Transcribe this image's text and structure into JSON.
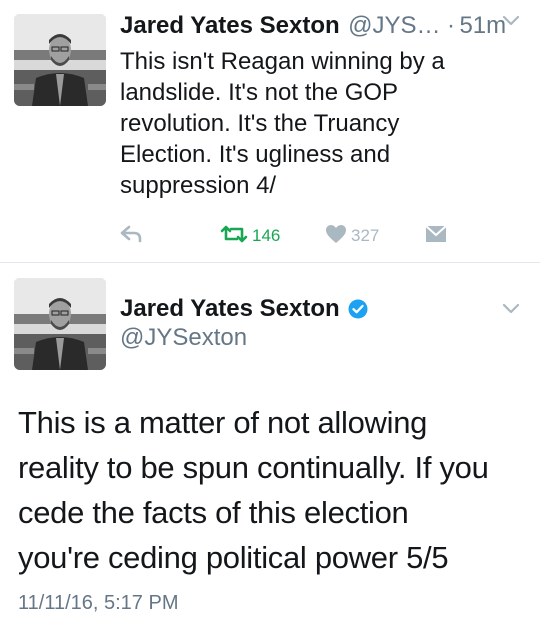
{
  "tweet1": {
    "name": "Jared Yates Sexton",
    "handle": "@JYS…",
    "dot": "·",
    "time": "51m",
    "text": "This isn't Reagan winning by a\nlandslide. It's not the GOP\nrevolution. It's the Truancy\nElection. It's ugliness and\nsuppression 4/",
    "retweet_count": "146",
    "like_count": "327",
    "icons": [
      "reply-icon",
      "retweet-icon",
      "heart-icon",
      "dm-icon",
      "chevron-down-icon"
    ],
    "colors": {
      "retweet": "#19a653",
      "muted": "#aab8c2",
      "handle": "#657786"
    }
  },
  "tweet2": {
    "name": "Jared Yates Sexton",
    "handle": "@JYSexton",
    "text": "This is a matter of not allowing\nreality to be spun continually. If you\ncede the facts of this election\nyou're ceding political power 5/5",
    "timestamp": "11/11/16, 5:17 PM",
    "icons": [
      "verified-badge-icon",
      "chevron-down-icon"
    ],
    "colors": {
      "verified": "#1da1f2"
    }
  }
}
